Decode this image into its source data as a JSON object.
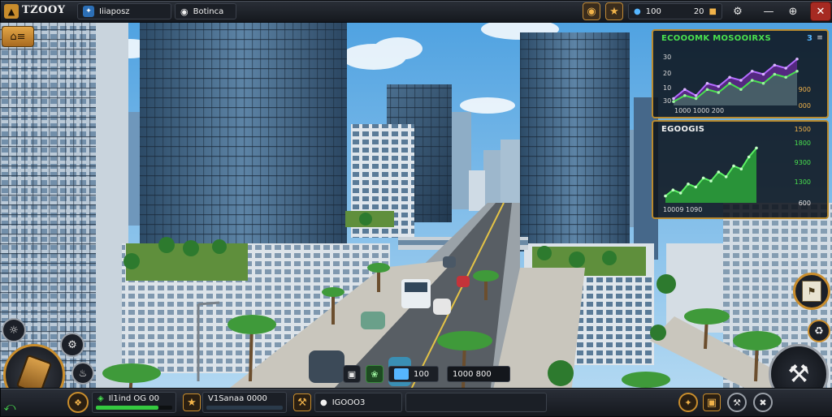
{
  "top_bar": {
    "brand": "TZOOY",
    "tab_1": {
      "icon": "share-icon",
      "label": "Iiiaposz"
    },
    "tab_2": {
      "icon": "globe-icon",
      "label": "Botinca"
    },
    "money_value": "100",
    "timer_value": "20"
  },
  "panel_top": {
    "title": "ECOOOMK MOSOOIRXS",
    "right_marker": "3",
    "y_labels": [
      "30",
      "20",
      "10",
      "30"
    ],
    "right_values": [
      "900",
      "000"
    ],
    "x_label": "1000 1000 200"
  },
  "panel_bottom": {
    "title": "EGOOGIS",
    "values": [
      "1500",
      "1800",
      "9300",
      "1300",
      "600"
    ],
    "bottom_label": "10009 1090"
  },
  "bottom_bar": {
    "slot_1_label": "Il1ind OG 00",
    "slot_1_progress": 0.82,
    "slot_2_label": "V1Sanaa 0000",
    "slot_3_label": "IGOOO3",
    "map_slots": [
      "100",
      "1000 800"
    ]
  },
  "colors": {
    "accent_gold": "#b98a2e",
    "chart_green": "#2fc13a",
    "chart_purple": "#6a2a9a",
    "close_red": "#a62a22"
  },
  "chart_data": [
    {
      "type": "area",
      "title": "ECOOOMK MOSOOIRXS",
      "series": [
        {
          "values": [
            2,
            5,
            3,
            7,
            6,
            9,
            8,
            11,
            10,
            13,
            12,
            15
          ]
        },
        {
          "values": [
            1,
            3,
            2,
            5,
            4,
            7,
            5,
            8,
            7,
            10,
            9,
            11
          ]
        }
      ],
      "ylim": [
        0,
        16
      ],
      "grid": false
    },
    {
      "type": "area",
      "title": "EGOOGIS",
      "series": [
        {
          "values": [
            1,
            2,
            1.5,
            3,
            2.5,
            4,
            3.5,
            5,
            4.2,
            6,
            5.5,
            7.5,
            9
          ]
        }
      ],
      "ylim": [
        0,
        10
      ],
      "grid": false
    }
  ]
}
